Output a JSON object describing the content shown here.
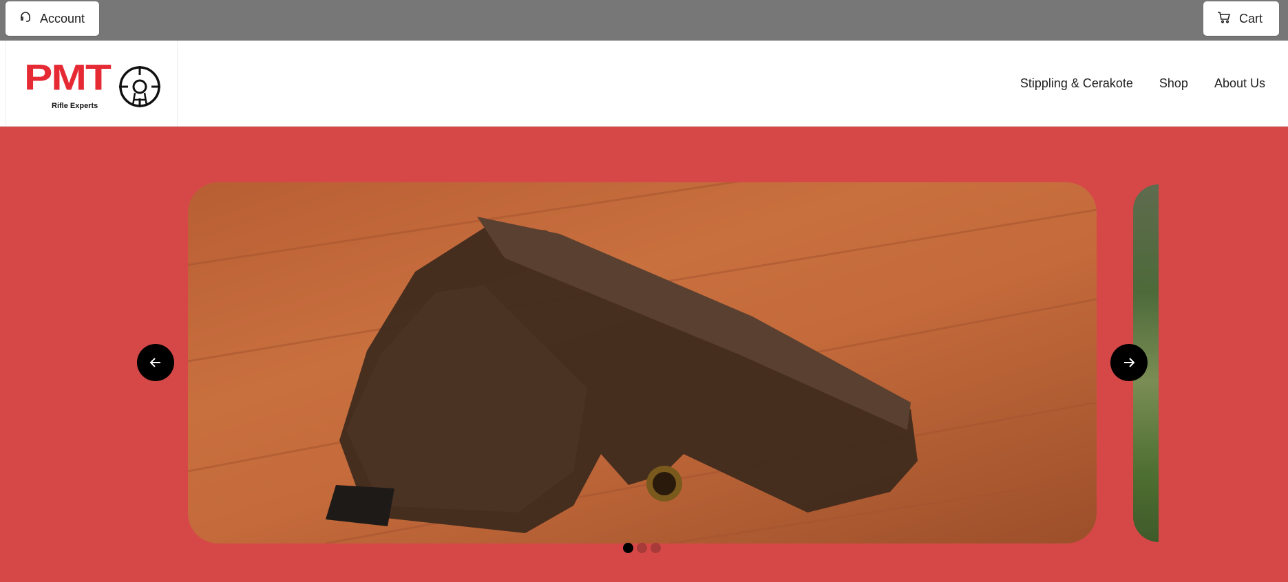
{
  "topbar": {
    "account_label": "Account",
    "cart_label": "Cart",
    "account_icon": "headset-icon",
    "cart_icon": "cart-icon"
  },
  "logo": {
    "text": "PMT",
    "subtitle": "Rifle Experts",
    "icon": "crosshair-icon",
    "color": "#e52a34"
  },
  "nav": {
    "items": [
      {
        "label": "Stippling & Cerakote"
      },
      {
        "label": "Shop"
      },
      {
        "label": "About Us"
      }
    ]
  },
  "hero": {
    "background_color": "#d64848",
    "slides": [
      {
        "image": "pistol-on-wooden-deck"
      },
      {
        "image": "green-foliage"
      }
    ],
    "prev_icon": "arrow-left-icon",
    "next_icon": "arrow-right-icon",
    "active_slide": 1,
    "slide_count": 3
  }
}
